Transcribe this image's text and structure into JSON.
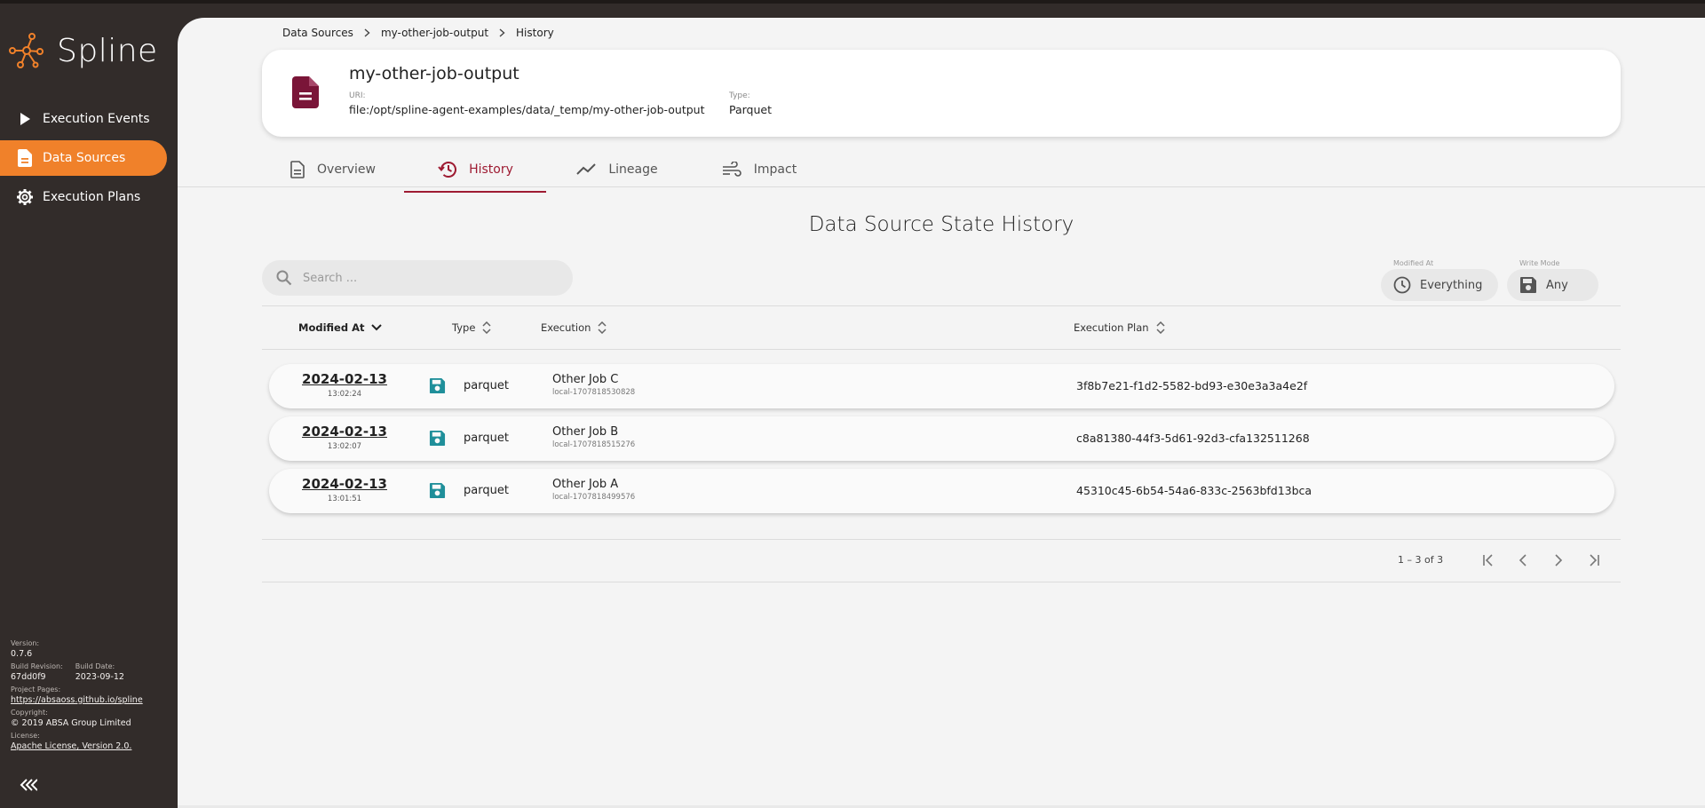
{
  "app": {
    "name": "Spline"
  },
  "sidebar": {
    "items": [
      {
        "label": "Execution Events",
        "icon": "play-icon",
        "active": false
      },
      {
        "label": "Data Sources",
        "icon": "document-icon",
        "active": true
      },
      {
        "label": "Execution Plans",
        "icon": "gear-icon",
        "active": false
      }
    ],
    "info": {
      "version_label": "Version:",
      "version": "0.7.6",
      "build_revision_label": "Build Revision:",
      "build_revision": "67dd0f9",
      "build_date_label": "Build Date:",
      "build_date": "2023-09-12",
      "project_pages_label": "Project Pages:",
      "project_pages": "https://absaoss.github.io/spline",
      "copyright_label": "Copyright:",
      "copyright": "© 2019 ABSA Group Limited",
      "license_label": "License:",
      "license": "Apache License, Version 2.0."
    },
    "collapse_icon": "double-chevron-left-icon"
  },
  "breadcrumb": [
    "Data Sources",
    "my-other-job-output",
    "History"
  ],
  "data_source": {
    "name": "my-other-job-output",
    "uri_label": "URI:",
    "uri": "file:/opt/spline-agent-examples/data/_temp/my-other-job-output",
    "type_label": "Type:",
    "type": "Parquet"
  },
  "tabs": [
    {
      "label": "Overview",
      "icon": "document-outline-icon",
      "active": false
    },
    {
      "label": "History",
      "icon": "history-icon",
      "active": true
    },
    {
      "label": "Lineage",
      "icon": "trend-line-icon",
      "active": false
    },
    {
      "label": "Impact",
      "icon": "wind-icon",
      "active": false
    }
  ],
  "history": {
    "title": "Data Source State History",
    "search_placeholder": "Search ...",
    "filters": {
      "modified_at": {
        "label": "Modified At",
        "value": "Everything",
        "icon": "clock-icon"
      },
      "write_mode": {
        "label": "Write Mode",
        "value": "Any",
        "icon": "save-icon"
      }
    },
    "columns": {
      "modified_at": "Modified At",
      "type": "Type",
      "execution": "Execution",
      "execution_plan": "Execution Plan"
    },
    "rows": [
      {
        "date": "2024-02-13",
        "time": "13:02:24",
        "type": "parquet",
        "execution": "Other Job C",
        "execution_id": "local-1707818530828",
        "plan": "3f8b7e21-f1d2-5582-bd93-e30e3a3a4e2f"
      },
      {
        "date": "2024-02-13",
        "time": "13:02:07",
        "type": "parquet",
        "execution": "Other Job B",
        "execution_id": "local-1707818515276",
        "plan": "c8a81380-44f3-5d61-92d3-cfa132511268"
      },
      {
        "date": "2024-02-13",
        "time": "13:01:51",
        "type": "parquet",
        "execution": "Other Job A",
        "execution_id": "local-1707818499576",
        "plan": "45310c45-6b54-54a6-833c-2563bfd13bca"
      }
    ],
    "pagination": {
      "label": "1 – 3 of 3"
    }
  },
  "colors": {
    "sidebar_bg": "#322c2a",
    "accent_orange": "#f0812a",
    "active_tab": "#9e1b32",
    "doc_icon": "#7a1538",
    "save_icon_teal": "#1f8f9a",
    "main_bg": "#f4f4f4"
  }
}
